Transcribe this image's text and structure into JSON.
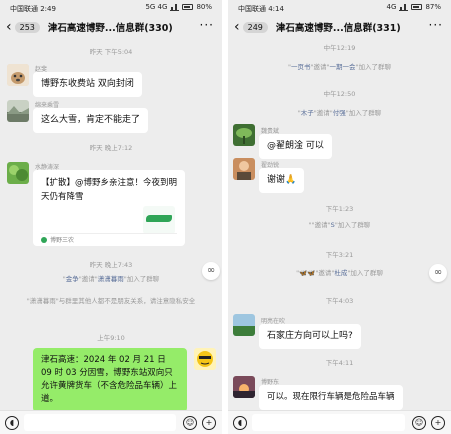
{
  "panel_left": {
    "status": {
      "carrier": "中国联通 2:49",
      "indicators": "5G 4G",
      "battery": "80%"
    },
    "header": {
      "back_icon": "chevron-left-icon",
      "unread": "253",
      "title": "津石高速博野...信息群(330)",
      "more_icon": "ellipsis-icon"
    },
    "messages": {
      "t1": "昨天 下午5:04",
      "m1": {
        "nick": "赵斐",
        "text": "博野东收费站 双向封闭"
      },
      "m2": {
        "nick": "绵来乘雪",
        "text": "这么大雪，肯定不能走了"
      },
      "t2": "昨天 晚上7:12",
      "m3": {
        "nick": "水静涛深",
        "card_text": "【扩散】@博野乡亲注意！今夜到明天仍有降雪",
        "card_source": "博野三农"
      },
      "t3": "昨天 晚上7:43",
      "sys1": {
        "inviter": "金争",
        "mid": "邀请",
        "invitee": "潇潇暮雨",
        "tail": "加入了群聊"
      },
      "sys2": "\"潇潇暮雨\"与群里其他人都不是朋友关系，请注意隐私安全",
      "t4": "上午9:10",
      "m4": {
        "text": "津石高速：2024 年 02 月 21 日 09 时 03 分因雪，博野东站双向只允许黄牌货车（不含危险品车辆）上道。"
      }
    },
    "input": {
      "voice_icon": "voice-icon",
      "emoji_icon": "emoji-icon",
      "plus_icon": "plus-icon"
    }
  },
  "panel_right": {
    "status": {
      "carrier": "中国联通 4:14",
      "indicators": "4G",
      "battery": "87%"
    },
    "header": {
      "back_icon": "chevron-left-icon",
      "unread": "249",
      "title": "津石高速博野...信息群(331)",
      "more_icon": "ellipsis-icon"
    },
    "messages": {
      "t0": "中午12:19",
      "sys1": {
        "inviter": "一页书",
        "mid": "邀请",
        "invitee": "一期一会",
        "tail": "加入了群聊"
      },
      "t1": "中午12:50",
      "sys2": {
        "inviter": "木子",
        "mid": "邀请",
        "invitee": "付强",
        "tail": "加入了群聊"
      },
      "m1": {
        "nick": "魏贵斌",
        "text": "@翟朗淦  可以"
      },
      "m2": {
        "nick": "翟劲锐",
        "text": "谢谢🙏"
      },
      "t2": "下午1:23",
      "sys3": {
        "inviter": "",
        "mid": "邀请",
        "invitee": "S",
        "tail": "加入了群聊"
      },
      "t3": "下午3:21",
      "sys4": {
        "inviter": "🦋🦋",
        "mid": "邀请",
        "invitee": "杜成",
        "tail": "加入了群聊"
      },
      "t4": "下午4:03",
      "m3": {
        "nick": "明亮在吹",
        "text": "石家庄方向可以上吗?"
      },
      "t5": "下午4:11",
      "m4": {
        "nick": "博野东",
        "text": "可以。现在限行车辆是危险品车辆"
      }
    },
    "input": {
      "voice_icon": "voice-icon",
      "emoji_icon": "emoji-icon",
      "plus_icon": "plus-icon"
    }
  }
}
